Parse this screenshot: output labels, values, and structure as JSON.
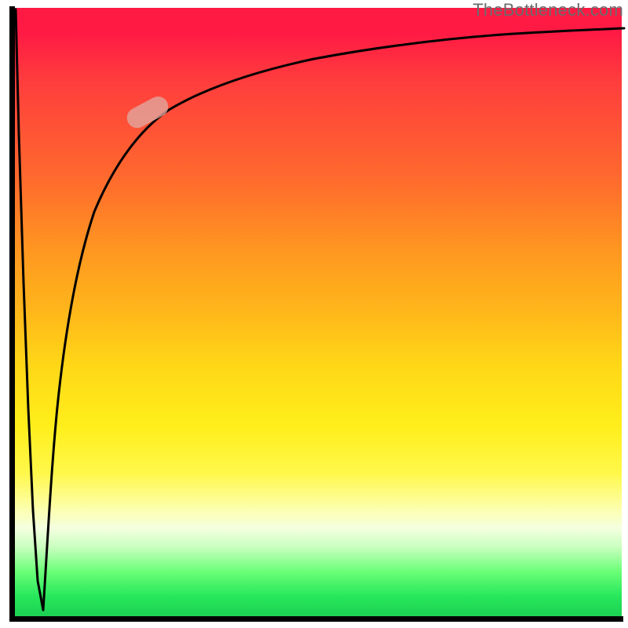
{
  "watermark": {
    "text": "TheBottleneck.com"
  },
  "colors": {
    "axis": "#000000",
    "curve": "#000000",
    "marker": "rgba(224,168,160,0.78)",
    "gradient_stops": [
      "#ff1a44",
      "#ff3d3d",
      "#ff6a2d",
      "#ff9820",
      "#ffb81a",
      "#ffd617",
      "#ffee1a",
      "#fff84a",
      "#fcffb0",
      "#f4ffe0",
      "#caffc0",
      "#6cff78",
      "#28e85c",
      "#1acc50"
    ]
  },
  "chart_data": {
    "type": "line",
    "title": "",
    "xlabel": "",
    "ylabel": "",
    "xlim": [
      0,
      100
    ],
    "ylim": [
      0,
      100
    ],
    "grid": false,
    "series": [
      {
        "name": "spike-down",
        "x": [
          0.5,
          1.2,
          2.0,
          2.8,
          3.5,
          4.2,
          5.0
        ],
        "y": [
          99.5,
          78,
          55,
          35,
          18,
          6,
          1.5
        ]
      },
      {
        "name": "rising-curve",
        "x": [
          5.0,
          6,
          7,
          8,
          9,
          10,
          12,
          14,
          16,
          18,
          20,
          24,
          28,
          32,
          36,
          40,
          46,
          52,
          60,
          70,
          80,
          90,
          100
        ],
        "y": [
          1.5,
          18,
          32,
          43,
          52,
          59,
          68,
          74,
          78,
          81,
          83.5,
          86.5,
          88.5,
          90,
          91,
          92,
          93,
          93.8,
          94.6,
          95.3,
          95.8,
          96.2,
          96.5
        ]
      }
    ],
    "marker": {
      "name": "highlight-segment",
      "x": 22,
      "y": 85,
      "angle_deg": -28
    },
    "legend": false
  }
}
